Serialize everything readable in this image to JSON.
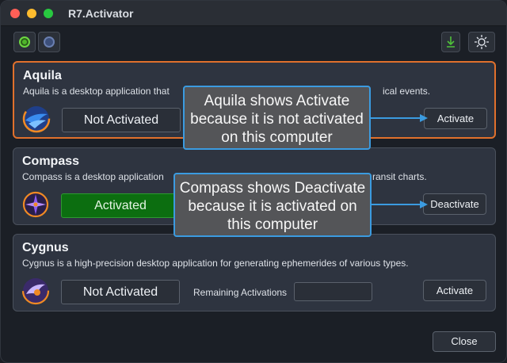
{
  "window": {
    "title": "R7.Activator"
  },
  "apps": [
    {
      "name": "Aquila",
      "description": "Aquila is a desktop application that",
      "description_tail": "ical events.",
      "status": "Not Activated",
      "action": "Activate"
    },
    {
      "name": "Compass",
      "description": "Compass is a desktop application",
      "description_tail": "ransit charts.",
      "status": "Activated",
      "action": "Deactivate"
    },
    {
      "name": "Cygnus",
      "description": "Cygnus is a high-precision desktop application for generating ephemerides of various types.",
      "status": "Not Activated",
      "action": "Activate",
      "remaining_label": "Remaining Activations",
      "remaining_value": ""
    }
  ],
  "callouts": {
    "aquila": "Aquila shows Activate because it is not activated on this computer",
    "compass": "Compass shows Deactivate because it is activated on this computer"
  },
  "footer": {
    "close_label": "Close"
  },
  "colors": {
    "accent_border": "#e0702c",
    "activated_green": "#0c6e10",
    "callout_border": "#3b9be0"
  },
  "icons": {
    "toolbar_left": [
      "green-circle-icon",
      "blue-circle-icon"
    ],
    "toolbar_right": [
      "download-icon",
      "sun-icon"
    ]
  }
}
